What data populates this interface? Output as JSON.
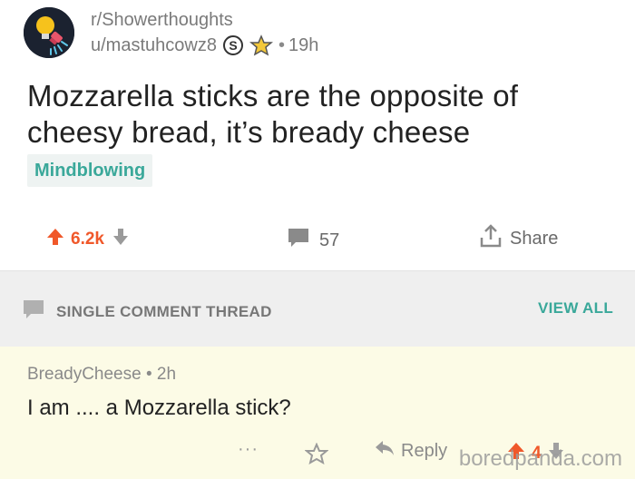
{
  "post": {
    "subreddit": "r/Showerthoughts",
    "username": "u/mastuhcowz8",
    "age": "19h",
    "dot": "•",
    "title": "Mozzarella sticks are the opposite of cheesy bread, it’s bready cheese",
    "flair": "Mindblowing",
    "votes": "6.2k",
    "comments": "57",
    "share_label": "Share"
  },
  "thread_bar": {
    "label": "SINGLE COMMENT THREAD",
    "view_all": "VIEW ALL"
  },
  "comment": {
    "author": "BreadyCheese",
    "dot": "•",
    "age": "2h",
    "body": "I am .... a Mozzarella stick?",
    "more": "···",
    "reply_label": "Reply",
    "votes": "4"
  },
  "watermark": "boredpanda.com",
  "colors": {
    "upvote": "#f0582a",
    "accent_teal": "#3aa89a",
    "comment_bg": "#fcfbe6",
    "thread_bar_bg": "#efefef"
  }
}
